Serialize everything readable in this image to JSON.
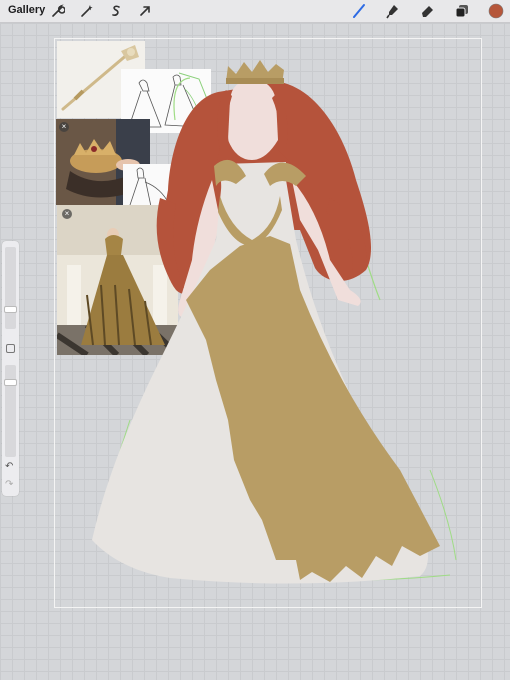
{
  "toolbar": {
    "gallery_label": "Gallery",
    "left_tools": [
      "wrench-icon",
      "magic-wand-icon",
      "selection-icon",
      "transform-arrow-icon"
    ],
    "right_tools": [
      "brush-icon",
      "smudge-icon",
      "eraser-icon",
      "layers-icon"
    ],
    "active_color": "#b5563a",
    "accent": "#2d6be4"
  },
  "sidebar": {
    "brush_size": 0.22,
    "opacity": 0.36
  },
  "colors": {
    "hair": "#b5533b",
    "skin": "#f0dedb",
    "dress": "#e7e4e1",
    "gold": "#b89d65",
    "sketch_green": "#9fdc85"
  }
}
